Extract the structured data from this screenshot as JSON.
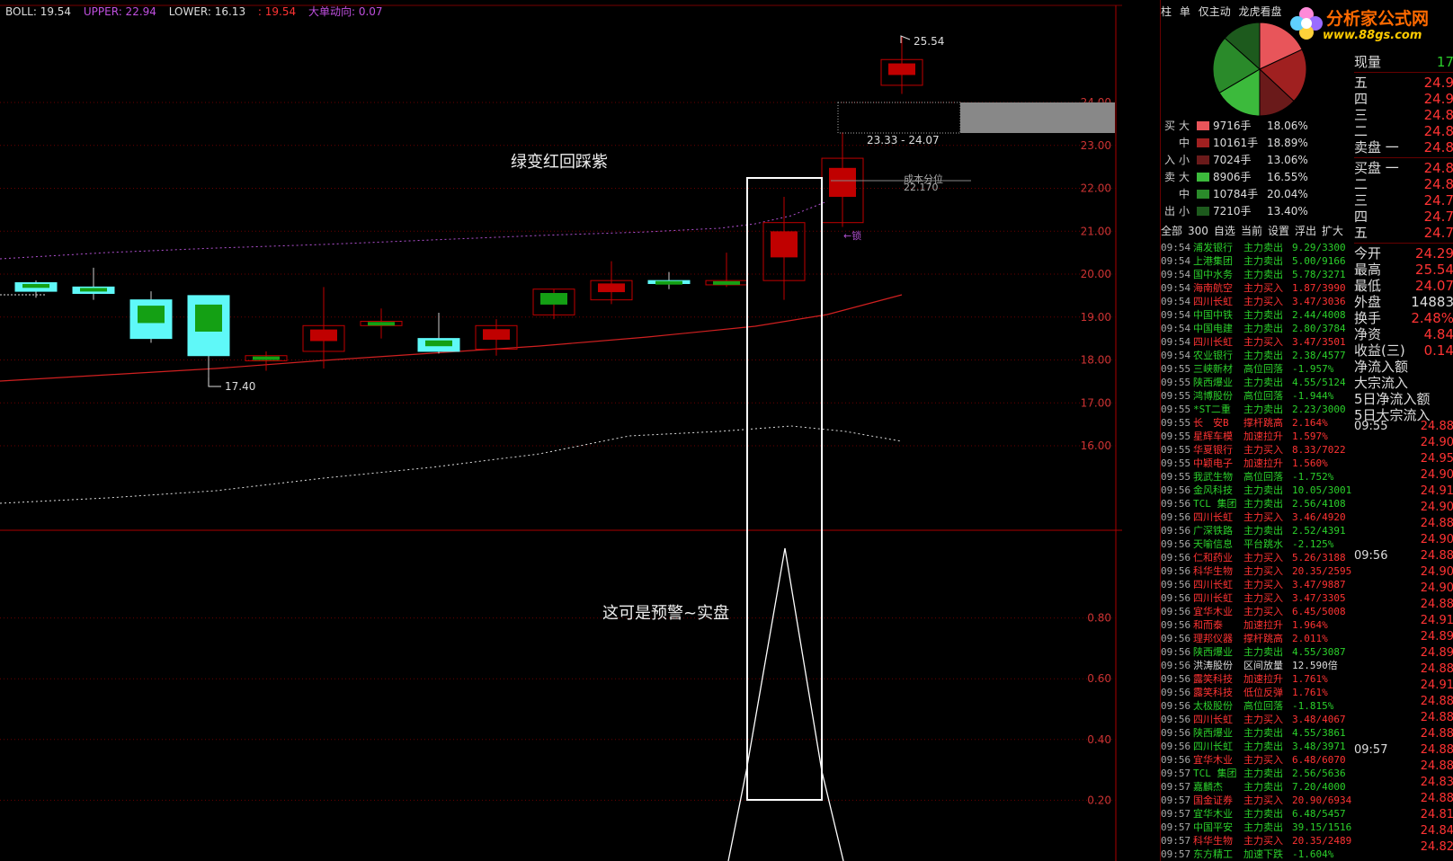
{
  "indicator_bar": {
    "boll": "BOLL: 19.54",
    "upper": "UPPER: 22.94",
    "lower": "LOWER: 16.13",
    "extra": ": 19.54",
    "big_order": "大单动向: 0.07"
  },
  "price_axis": [
    "24.00",
    "23.00",
    "22.00",
    "21.00",
    "20.00",
    "19.00",
    "18.00",
    "17.00",
    "16.00"
  ],
  "sub_axis": [
    "0.80",
    "0.60",
    "0.40",
    "0.20"
  ],
  "annotations": {
    "title_note": "绿变红回踩紫",
    "warning_note": "这可是预警~实盘",
    "high_label": "25.54",
    "low_label": "17.40",
    "range_label": "23.33 - 24.07",
    "cost_label": "成本分位",
    "cost_value": "22.170",
    "lock_label": "←锁"
  },
  "right_panel": {
    "tabs": [
      "柱",
      "单",
      "仅主动",
      "龙虎看盘"
    ],
    "logo_text": "分析家公式网",
    "logo_url": "www.88gs.com",
    "flows": [
      {
        "side": "买",
        "size": "大",
        "color": "#e8555a",
        "hands": "9716手",
        "pct": "18.06%"
      },
      {
        "side": "",
        "size": "中",
        "color": "#a02020",
        "hands": "10161手",
        "pct": "18.89%"
      },
      {
        "side": "入",
        "size": "小",
        "color": "#6a1a1a",
        "hands": "7024手",
        "pct": "13.06%"
      },
      {
        "side": "卖",
        "size": "大",
        "color": "#3cba3c",
        "hands": "8906手",
        "pct": "16.55%"
      },
      {
        "side": "",
        "size": "中",
        "color": "#2a8a2a",
        "hands": "10784手",
        "pct": "20.04%"
      },
      {
        "side": "出",
        "size": "小",
        "color": "#1d5a1d",
        "hands": "7210手",
        "pct": "13.40%"
      }
    ],
    "toolbar": [
      "全部",
      "300",
      "自选",
      "当前",
      "设置",
      "浮出",
      "扩大"
    ],
    "deals": [
      [
        "09:54",
        "浦发银行",
        "主力卖出",
        "9.29/3300",
        "g"
      ],
      [
        "09:54",
        "上港集团",
        "主力卖出",
        "5.00/9166",
        "g"
      ],
      [
        "09:54",
        "国中水务",
        "主力卖出",
        "5.78/3271",
        "g"
      ],
      [
        "09:54",
        "海南航空",
        "主力买入",
        "1.87/3990",
        "r"
      ],
      [
        "09:54",
        "四川长虹",
        "主力买入",
        "3.47/3036",
        "r"
      ],
      [
        "09:54",
        "中国中铁",
        "主力卖出",
        "2.44/4008",
        "g"
      ],
      [
        "09:54",
        "中国电建",
        "主力卖出",
        "2.80/3784",
        "g"
      ],
      [
        "09:54",
        "四川长虹",
        "主力买入",
        "3.47/3501",
        "r"
      ],
      [
        "09:54",
        "农业银行",
        "主力卖出",
        "2.38/4577",
        "g"
      ],
      [
        "09:55",
        "三峡新材",
        "高位回落",
        "-1.957%",
        "g"
      ],
      [
        "09:55",
        "陕西爆业",
        "主力卖出",
        "4.55/5124",
        "g"
      ],
      [
        "09:55",
        "鸿博股份",
        "高位回落",
        "-1.944%",
        "g"
      ],
      [
        "09:55",
        "*ST二重",
        "主力卖出",
        "2.23/3000",
        "g"
      ],
      [
        "09:55",
        "长　安B",
        "撑杆跳高",
        "2.164%",
        "r"
      ],
      [
        "09:55",
        "星辉车模",
        "加速拉升",
        "1.597%",
        "r"
      ],
      [
        "09:55",
        "华夏银行",
        "主力买入",
        "8.33/7022",
        "r"
      ],
      [
        "09:55",
        "中颖电子",
        "加速拉升",
        "1.560%",
        "r"
      ],
      [
        "09:55",
        "我武生物",
        "高位回落",
        "-1.752%",
        "g"
      ],
      [
        "09:56",
        "金风科技",
        "主力卖出",
        "10.05/3001",
        "g"
      ],
      [
        "09:56",
        "TCL 集团",
        "主力卖出",
        "2.56/4108",
        "g"
      ],
      [
        "09:56",
        "四川长虹",
        "主力买入",
        "3.46/4920",
        "r"
      ],
      [
        "09:56",
        "广深铁路",
        "主力卖出",
        "2.52/4391",
        "g"
      ],
      [
        "09:56",
        "天喻信息",
        "平台跳水",
        "-2.125%",
        "g"
      ],
      [
        "09:56",
        "仁和药业",
        "主力买入",
        "5.26/3188",
        "r"
      ],
      [
        "09:56",
        "科华生物",
        "主力买入",
        "20.35/2595",
        "r"
      ],
      [
        "09:56",
        "四川长虹",
        "主力买入",
        "3.47/9887",
        "r"
      ],
      [
        "09:56",
        "四川长虹",
        "主力买入",
        "3.47/3305",
        "r"
      ],
      [
        "09:56",
        "宜华木业",
        "主力买入",
        "6.45/5008",
        "r"
      ],
      [
        "09:56",
        "和而泰",
        "加速拉升",
        "1.964%",
        "r"
      ],
      [
        "09:56",
        "理邦仪器",
        "撑杆跳高",
        "2.011%",
        "r"
      ],
      [
        "09:56",
        "陕西爆业",
        "主力卖出",
        "4.55/3087",
        "g"
      ],
      [
        "09:56",
        "洪涛股份",
        "区间放量",
        "12.590倍",
        "w"
      ],
      [
        "09:56",
        "露笑科技",
        "加速拉升",
        "1.761%",
        "r"
      ],
      [
        "09:56",
        "露笑科技",
        "低位反弹",
        "1.761%",
        "r"
      ],
      [
        "09:56",
        "太极股份",
        "高位回落",
        "-1.815%",
        "g"
      ],
      [
        "09:56",
        "四川长虹",
        "主力买入",
        "3.48/4067",
        "r"
      ],
      [
        "09:56",
        "陕西爆业",
        "主力卖出",
        "4.55/3861",
        "g"
      ],
      [
        "09:56",
        "四川长虹",
        "主力卖出",
        "3.48/3971",
        "g"
      ],
      [
        "09:56",
        "宜华木业",
        "主力买入",
        "6.48/6070",
        "r"
      ],
      [
        "09:57",
        "TCL 集团",
        "主力卖出",
        "2.56/5636",
        "g"
      ],
      [
        "09:57",
        "嘉麟杰",
        "主力卖出",
        "7.20/4000",
        "g"
      ],
      [
        "09:57",
        "国金证券",
        "主力买入",
        "20.90/6934",
        "r"
      ],
      [
        "09:57",
        "宜华木业",
        "主力卖出",
        "6.48/5457",
        "g"
      ],
      [
        "09:57",
        "中国平安",
        "主力卖出",
        "39.15/1516",
        "g"
      ],
      [
        "09:57",
        "科华生物",
        "主力买入",
        "20.35/2489",
        "r"
      ],
      [
        "09:57",
        "东方精工",
        "加速下跌",
        "-1.604%",
        "g"
      ]
    ],
    "quote": {
      "now_label": "现量",
      "now_value": "17",
      "sells": [
        [
          "五",
          "24.9"
        ],
        [
          "四",
          "24.9"
        ],
        [
          "三",
          "24.8"
        ],
        [
          "二",
          "24.8"
        ],
        [
          "卖盘 一",
          "24.8"
        ]
      ],
      "buys": [
        [
          "买盘 一",
          "24.8"
        ],
        [
          "二",
          "24.8"
        ],
        [
          "三",
          "24.7"
        ],
        [
          "四",
          "24.7"
        ],
        [
          "五",
          "24.7"
        ]
      ],
      "stats": [
        [
          "今开",
          "24.29"
        ],
        [
          "最高",
          "25.54"
        ],
        [
          "最低",
          "24.07"
        ],
        [
          "外盘",
          "14883"
        ],
        [
          "换手",
          "2.48%"
        ],
        [
          "净资",
          "4.84"
        ],
        [
          "收益(三)",
          "0.14"
        ]
      ],
      "flow_labels": [
        "净流入额",
        "大宗流入",
        "5日净流入额",
        "5日大宗流入"
      ]
    },
    "ticks": [
      [
        "09:55",
        "24.88"
      ],
      [
        "",
        "24.90"
      ],
      [
        "",
        "24.95"
      ],
      [
        "",
        "24.90"
      ],
      [
        "",
        "24.91"
      ],
      [
        "",
        "24.90"
      ],
      [
        "",
        "24.88"
      ],
      [
        "",
        "24.90"
      ],
      [
        "09:56",
        "24.88"
      ],
      [
        "",
        "24.90"
      ],
      [
        "",
        "24.90"
      ],
      [
        "",
        "24.88"
      ],
      [
        "",
        "24.91"
      ],
      [
        "",
        "24.89"
      ],
      [
        "",
        "24.89"
      ],
      [
        "",
        "24.88"
      ],
      [
        "",
        "24.91"
      ],
      [
        "",
        "24.88"
      ],
      [
        "",
        "24.88"
      ],
      [
        "",
        "24.88"
      ],
      [
        "09:57",
        "24.88"
      ],
      [
        "",
        "24.88"
      ],
      [
        "",
        "24.83"
      ],
      [
        "",
        "24.88"
      ],
      [
        "",
        "24.81"
      ],
      [
        "",
        "24.84"
      ],
      [
        "",
        "24.82"
      ]
    ]
  },
  "colors": {
    "up": "#c00000",
    "down_green": "#14a014",
    "down_cyan": "#5ff8f8",
    "ma": "#d02020",
    "boll_upper": "#b050d0",
    "axis": "#c33"
  }
}
